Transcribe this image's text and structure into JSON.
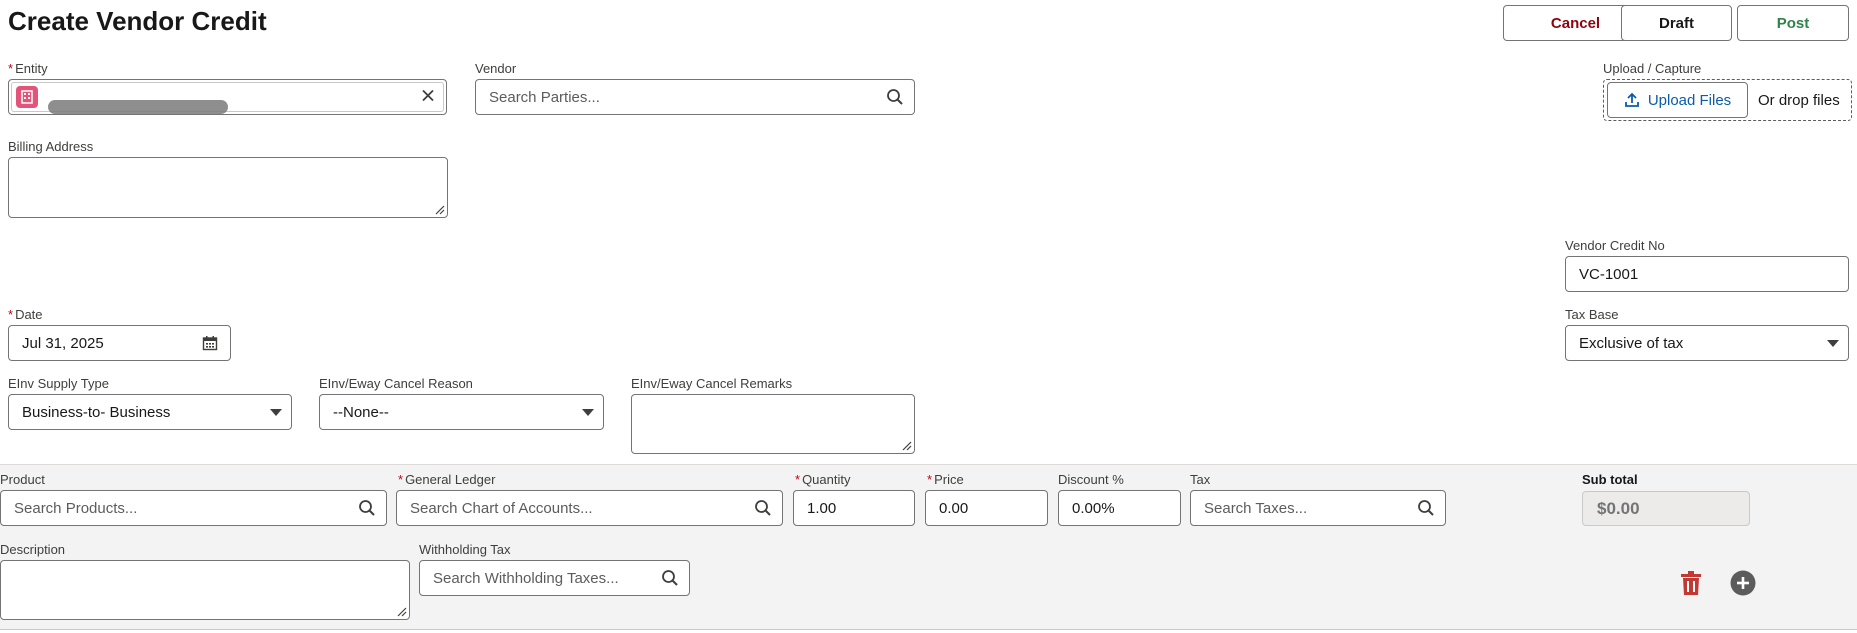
{
  "header": {
    "title": "Create Vendor Credit",
    "cancel_label": "Cancel",
    "draft_label": "Draft",
    "post_label": "Post"
  },
  "form": {
    "entity": {
      "label": "Entity",
      "value": "",
      "required_marker": "*"
    },
    "vendor": {
      "label": "Vendor",
      "placeholder": "Search Parties..."
    },
    "upload": {
      "label": "Upload / Capture",
      "button_label": "Upload Files",
      "drop_text": "Or drop files"
    },
    "billing_address": {
      "label": "Billing Address",
      "value": ""
    },
    "vendor_credit_no": {
      "label": "Vendor Credit No",
      "value": "VC-1001"
    },
    "date": {
      "label": "Date",
      "value": "Jul 31, 2025",
      "required_marker": "*"
    },
    "tax_base": {
      "label": "Tax Base",
      "value": "Exclusive of tax"
    },
    "einv_supply_type": {
      "label": "EInv Supply Type",
      "value": "Business-to- Business"
    },
    "cancel_reason": {
      "label": "EInv/Eway Cancel Reason",
      "value": "--None--"
    },
    "cancel_remarks": {
      "label": "EInv/Eway Cancel Remarks",
      "value": ""
    }
  },
  "line_item": {
    "product": {
      "label": "Product",
      "placeholder": "Search Products..."
    },
    "general_ledger": {
      "label": "General Ledger",
      "placeholder": "Search Chart of Accounts...",
      "required_marker": "*"
    },
    "quantity": {
      "label": "Quantity",
      "value": "1.00",
      "required_marker": "*"
    },
    "price": {
      "label": "Price",
      "value": "0.00",
      "required_marker": "*"
    },
    "discount": {
      "label": "Discount %",
      "value": "0.00%"
    },
    "tax": {
      "label": "Tax",
      "placeholder": "Search Taxes..."
    },
    "sub_total": {
      "label": "Sub total",
      "value": "$0.00"
    },
    "description": {
      "label": "Description",
      "value": ""
    },
    "withholding_tax": {
      "label": "Withholding Tax",
      "placeholder": "Search Withholding Taxes..."
    }
  },
  "colors": {
    "cancel": "#8e030f",
    "post": "#2e844a",
    "link": "#0b5cab",
    "entity_badge": "#e3547a",
    "delete_icon": "#c23934",
    "add_icon": "#5c5c5c"
  },
  "icons": [
    "search-icon",
    "clear-icon",
    "building-icon",
    "upload-icon",
    "calendar-icon",
    "chevron-down-icon",
    "trash-icon",
    "add-circle-icon"
  ]
}
